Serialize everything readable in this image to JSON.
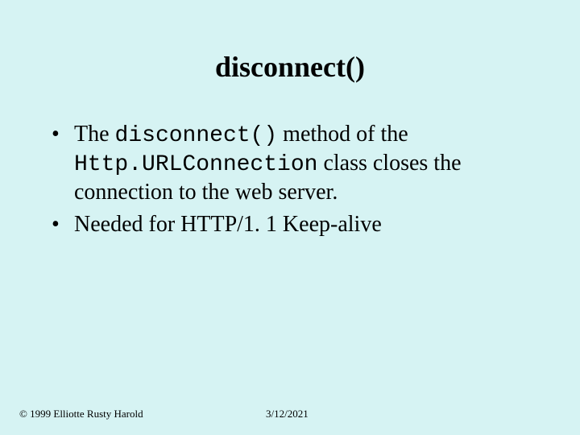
{
  "title": "disconnect()",
  "bullets": [
    {
      "pre1": "The ",
      "code1": "disconnect()",
      "mid1": " method of the ",
      "code2": "Http.URLConnection",
      "post1": " class closes the connection to the web server."
    },
    {
      "text": "Needed for HTTP/1. 1 Keep-alive"
    }
  ],
  "footer": {
    "copyright": "© 1999 Elliotte Rusty Harold",
    "date": "3/12/2021"
  }
}
